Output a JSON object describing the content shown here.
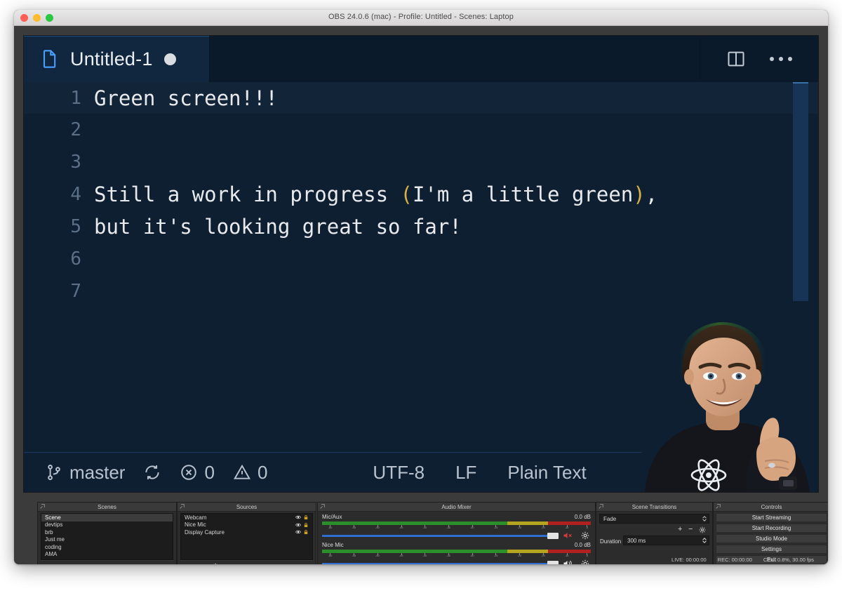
{
  "window": {
    "title": "OBS 24.0.6 (mac) - Profile: Untitled - Scenes: Laptop"
  },
  "editor": {
    "tab": {
      "filename": "Untitled-1",
      "file_icon": "file-icon",
      "dirty_indicator": "unsaved-dot"
    },
    "actions": {
      "split_icon": "split-editor-icon",
      "more_icon": "more-actions-icon"
    },
    "lines": [
      {
        "number": "1",
        "text": "Green screen!!!",
        "current": true
      },
      {
        "number": "2",
        "text": "",
        "current": false
      },
      {
        "number": "3",
        "text": "",
        "current": false
      },
      {
        "number": "4",
        "pre": "Still a work in progress ",
        "open": "(",
        "inner": "I'm a little green",
        "close": ")",
        "post": ",",
        "current": false
      },
      {
        "number": "5",
        "text": "but it's looking great so far!",
        "current": false
      },
      {
        "number": "6",
        "text": "",
        "current": false
      },
      {
        "number": "7",
        "text": "",
        "current": false
      }
    ],
    "status": {
      "branch": "master",
      "branch_icon": "source-control-icon",
      "sync_icon": "sync-icon",
      "errors_icon": "error-icon",
      "errors": "0",
      "warnings_icon": "warning-icon",
      "warnings": "0",
      "encoding": "UTF-8",
      "eol": "LF",
      "language": "Plain Text"
    },
    "colors": {
      "background": "#0d1f31",
      "current_line": "#122437",
      "bracket": "#d7b04a",
      "line_number": "#5b7087"
    }
  },
  "obs": {
    "scenes": {
      "title": "Scenes",
      "items": [
        "Scene",
        "devtips",
        "brb",
        "Just me",
        "coding",
        "AMA"
      ],
      "selected": "Scene",
      "tools": [
        "+",
        "−",
        "chevron-up-icon",
        "chevron-down-icon"
      ]
    },
    "sources": {
      "title": "Sources",
      "items": [
        {
          "name": "Webcam",
          "visible_icon": "eye-icon",
          "lock_icon": "lock-icon"
        },
        {
          "name": "Nice Mic",
          "visible_icon": "eye-icon",
          "lock_icon": "lock-icon"
        },
        {
          "name": "Display Capture",
          "visible_icon": "eye-icon",
          "lock_icon": "lock-icon"
        }
      ],
      "tools": [
        "+",
        "−",
        "gear-icon",
        "chevron-up-icon",
        "chevron-down-icon"
      ]
    },
    "mixer": {
      "title": "Audio Mixer",
      "tracks": [
        {
          "name": "Mic/Aux",
          "level": "0.0 dB",
          "muted": true,
          "speaker_icon": "speaker-muted-icon",
          "gear_icon": "gear-icon"
        },
        {
          "name": "Nice Mic",
          "level": "0.0 dB",
          "muted": false,
          "speaker_icon": "speaker-icon",
          "gear_icon": "gear-icon"
        }
      ],
      "tick_labels": [
        "-60",
        "-55",
        "-50",
        "-45",
        "-40",
        "-35",
        "-30",
        "-25",
        "-20",
        "-15",
        "-10",
        "-5"
      ]
    },
    "transitions": {
      "title": "Scene Transitions",
      "selected": "Fade",
      "duration_label": "Duration",
      "duration_value": "300 ms",
      "tools": [
        "+",
        "−",
        "gear-icon"
      ]
    },
    "controls": {
      "title": "Controls",
      "buttons": [
        "Start Streaming",
        "Start Recording",
        "Studio Mode",
        "Settings",
        "Exit"
      ]
    },
    "status": {
      "live": "LIVE: 00:00:00",
      "rec": "REC: 00:00:00",
      "cpu": "CPU: 0.8%, 30.00 fps"
    }
  }
}
